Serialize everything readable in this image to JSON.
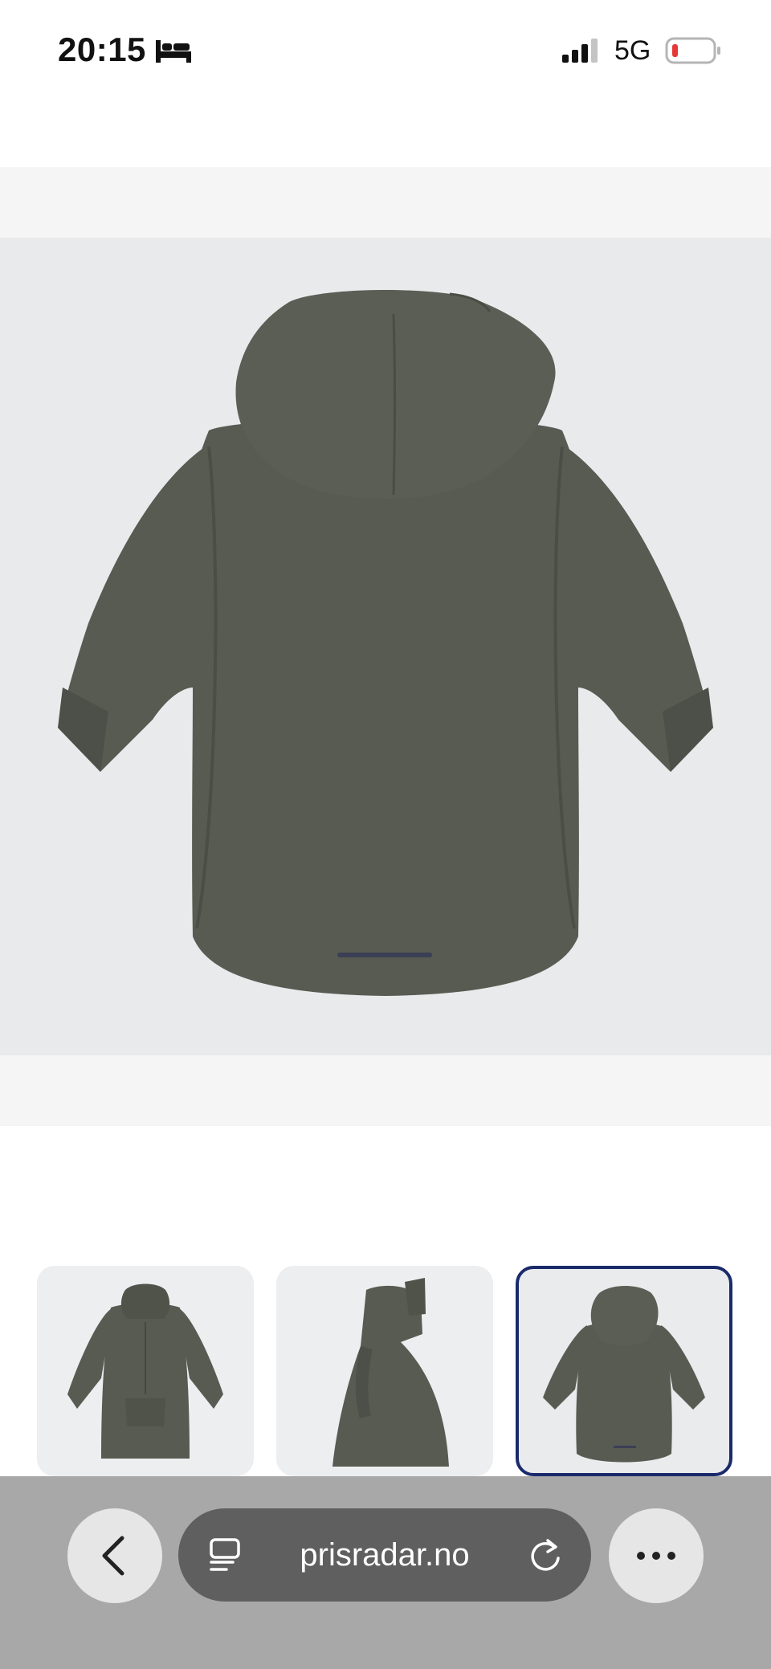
{
  "status_bar": {
    "time": "20:15",
    "network": "5G",
    "icons": [
      "bed-icon",
      "signal-icon",
      "battery-low-icon"
    ],
    "battery_color": "#e53935"
  },
  "product": {
    "main_image": "jacket-back-view",
    "jacket_color": "#575b52",
    "thumbnails": [
      {
        "image": "jacket-front-view",
        "selected": false
      },
      {
        "image": "jacket-side-view",
        "selected": false
      },
      {
        "image": "jacket-back-view",
        "selected": true
      }
    ],
    "selected_border_color": "#1b2a6b"
  },
  "browser": {
    "url": "prisradar.no",
    "icons": [
      "back-icon",
      "tabs-icon",
      "reload-icon",
      "more-icon"
    ]
  }
}
